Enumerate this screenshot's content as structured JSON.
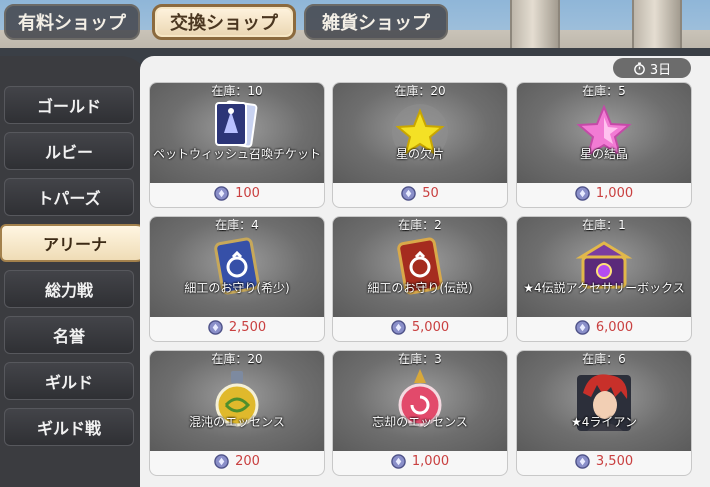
{
  "tabs": [
    {
      "label": "有料ショップ",
      "active": false
    },
    {
      "label": "交換ショップ",
      "active": true
    },
    {
      "label": "雑貨ショップ",
      "active": false
    }
  ],
  "sidebar": {
    "items": [
      {
        "label": "ゴールド"
      },
      {
        "label": "ルビー"
      },
      {
        "label": "トパーズ"
      },
      {
        "label": "アリーナ",
        "active": true
      },
      {
        "label": "総力戦"
      },
      {
        "label": "名誉"
      },
      {
        "label": "ギルド"
      },
      {
        "label": "ギルド戦"
      }
    ]
  },
  "timer": {
    "label": "3日",
    "icon": "stopwatch-icon"
  },
  "colors": {
    "price": "#c94040",
    "active_tab": "#ead6b1"
  },
  "items": [
    {
      "stock": "在庫：10",
      "name": "ペットウィッシュ召喚チケット",
      "price": "100",
      "icon": "summon-ticket-icon"
    },
    {
      "stock": "在庫：20",
      "name": "星の欠片",
      "price": "50",
      "icon": "yellow-star-icon"
    },
    {
      "stock": "在庫：5",
      "name": "星の結晶",
      "price": "1,000",
      "icon": "pink-star-icon"
    },
    {
      "stock": "在庫：4",
      "name": "細工のお守り(希少)",
      "price": "2,500",
      "icon": "blue-charm-icon"
    },
    {
      "stock": "在庫：2",
      "name": "細工のお守り(伝説)",
      "price": "5,000",
      "icon": "red-charm-icon"
    },
    {
      "stock": "在庫：1",
      "name": "★4伝説アクセサリーボックス",
      "price": "6,000",
      "icon": "accessory-box-icon"
    },
    {
      "stock": "在庫：20",
      "name": "混沌のエッセンス",
      "price": "200",
      "icon": "chaos-essence-icon"
    },
    {
      "stock": "在庫：3",
      "name": "忘却のエッセンス",
      "price": "1,000",
      "icon": "oblivion-essence-icon"
    },
    {
      "stock": "在庫：6",
      "name": "★4ライアン",
      "price": "3,500",
      "icon": "hero-portrait-icon"
    }
  ]
}
